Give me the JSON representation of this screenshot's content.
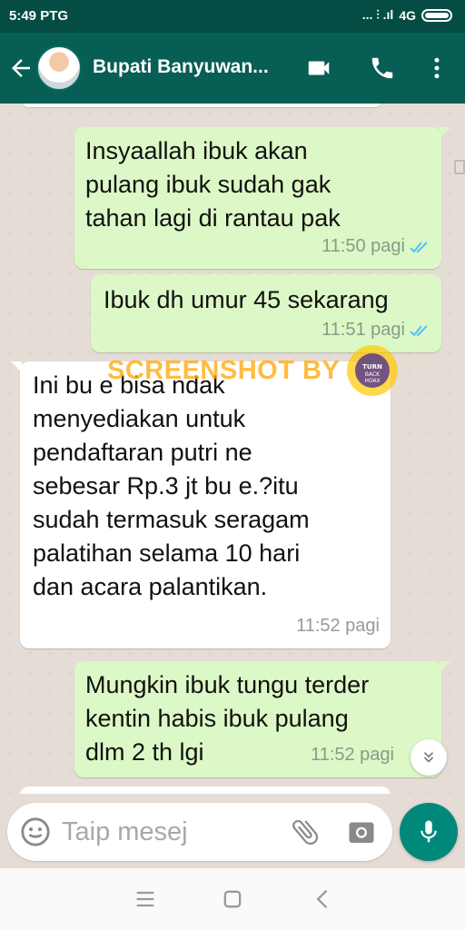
{
  "status_bar": {
    "time": "5:49 PTG",
    "network": "4G",
    "signal_text": "... ⫶ .ıl"
  },
  "header": {
    "contact_name": "Bupati Banyuwan...",
    "icons": [
      "back-arrow-icon",
      "avatar",
      "video-call-icon",
      "phone-icon",
      "more-vert-icon"
    ]
  },
  "messages": [
    {
      "direction": "out",
      "text": "Insyaallah ibuk akan\npulang ibuk sudah gak\ntahan lagi di rantau pak",
      "time": "11:50 pagi",
      "status": "read"
    },
    {
      "direction": "out",
      "text": "Ibuk dh umur 45 sekarang",
      "time": "11:51 pagi",
      "status": "read"
    },
    {
      "direction": "in",
      "text": "Ini bu e bisa ndak\nmenyediakan untuk\npendaftaran putri ne\nsebesar Rp.3 jt bu e.?itu\nsudah termasuk seragam\npalatihan selama 10 hari\ndan acara palantikan.",
      "time": "11:52 pagi"
    },
    {
      "direction": "out",
      "text": "Mungkin ibuk tungu terder\nkentin habis ibuk pulang\ndlm 2 th lgi",
      "time": "11:52 pagi",
      "status": "sent"
    }
  ],
  "watermark": {
    "text": "SCREENSHOT BY",
    "logo_text": "TURN BACK HOAX"
  },
  "input": {
    "placeholder": "Taip mesej"
  },
  "colors": {
    "header": "#075e54",
    "status_bar": "#054d44",
    "outgoing_bubble": "#dcf8c6",
    "incoming_bubble": "#ffffff",
    "mic_button": "#00897b",
    "read_ticks": "#4fc3f7"
  }
}
